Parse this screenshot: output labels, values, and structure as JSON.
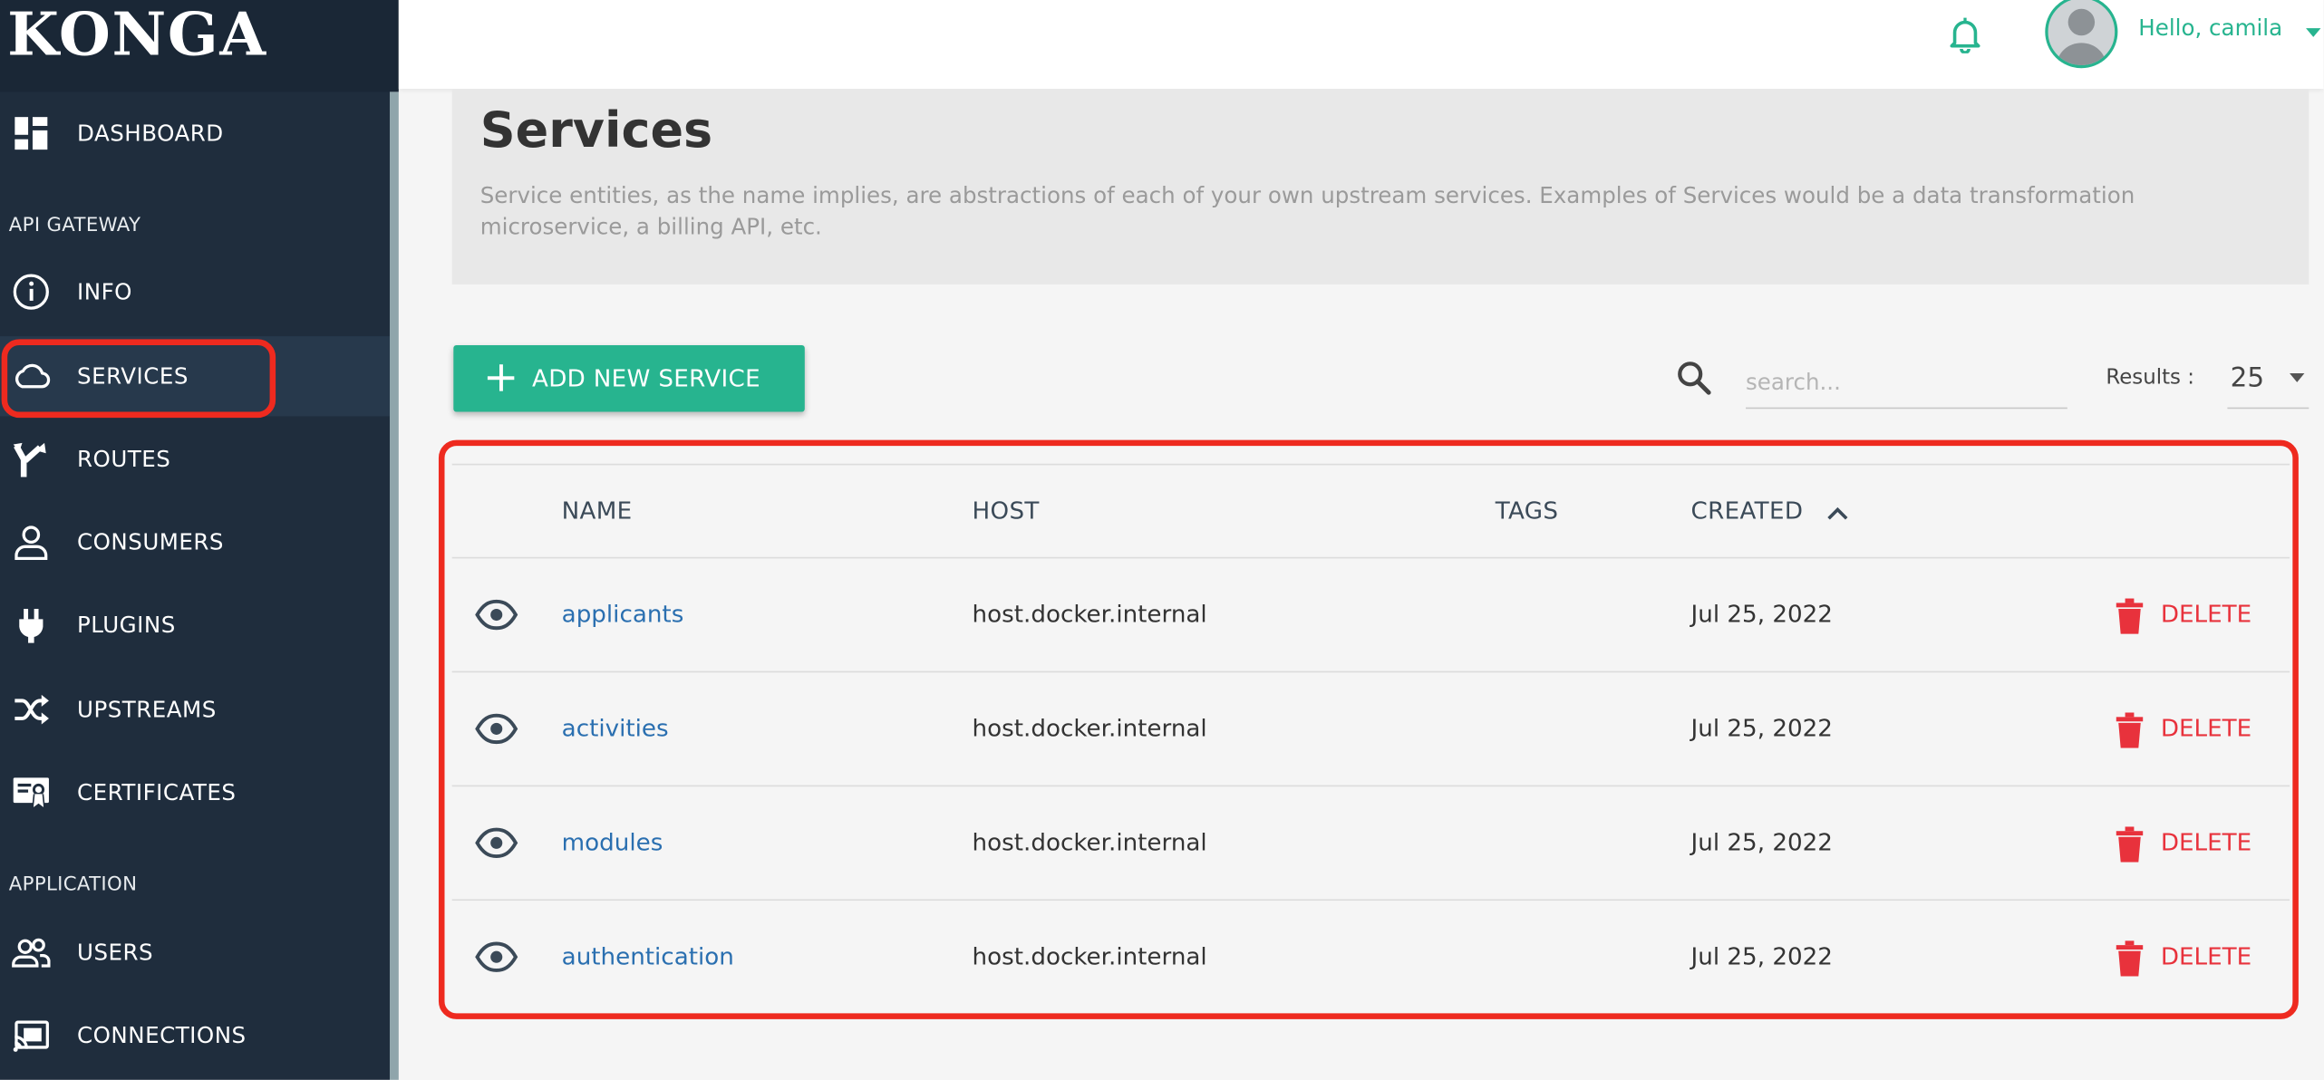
{
  "app": {
    "logo": "KONGA"
  },
  "header": {
    "greeting": "Hello, camila"
  },
  "sidebar": {
    "dashboard": "DASHBOARD",
    "section_api": "API GATEWAY",
    "section_app": "APPLICATION",
    "items": [
      {
        "label": "INFO",
        "icon": "info-icon"
      },
      {
        "label": "SERVICES",
        "icon": "cloud-icon",
        "active": true
      },
      {
        "label": "ROUTES",
        "icon": "route-icon"
      },
      {
        "label": "CONSUMERS",
        "icon": "user-icon"
      },
      {
        "label": "PLUGINS",
        "icon": "plug-icon"
      },
      {
        "label": "UPSTREAMS",
        "icon": "shuffle-icon"
      },
      {
        "label": "CERTIFICATES",
        "icon": "certificate-icon"
      }
    ],
    "app_items": [
      {
        "label": "USERS",
        "icon": "users-icon"
      },
      {
        "label": "CONNECTIONS",
        "icon": "cast-icon"
      }
    ]
  },
  "page": {
    "title": "Services",
    "description": "Service entities, as the name implies, are abstractions of each of your own upstream services. Examples of Services would be a data transformation microservice, a billing API, etc."
  },
  "toolbar": {
    "add_label": "ADD NEW SERVICE",
    "search_placeholder": "search...",
    "results_label": "Results :",
    "results_value": "25"
  },
  "table": {
    "columns": {
      "name": "NAME",
      "host": "HOST",
      "tags": "TAGS",
      "created": "CREATED"
    },
    "rows": [
      {
        "name": "applicants",
        "host": "host.docker.internal",
        "created": "Jul 25, 2022",
        "action": "DELETE"
      },
      {
        "name": "activities",
        "host": "host.docker.internal",
        "created": "Jul 25, 2022",
        "action": "DELETE"
      },
      {
        "name": "modules",
        "host": "host.docker.internal",
        "created": "Jul 25, 2022",
        "action": "DELETE"
      },
      {
        "name": "authentication",
        "host": "host.docker.internal",
        "created": "Jul 25, 2022",
        "action": "DELETE"
      }
    ]
  },
  "colors": {
    "sidebar": "#1f2d3d",
    "accent": "#27b48f",
    "link": "#2a6fb0",
    "danger": "#e8323c",
    "highlight": "#ee2a1f"
  }
}
